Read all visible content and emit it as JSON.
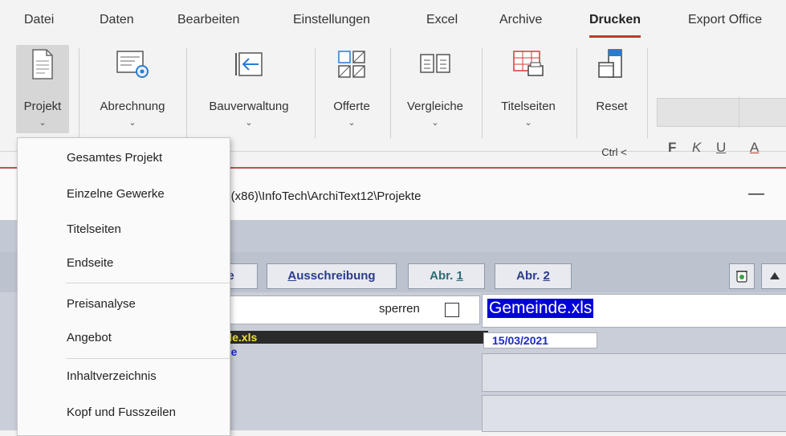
{
  "tabs": [
    {
      "label": "Datei"
    },
    {
      "label": "Daten"
    },
    {
      "label": "Bearbeiten"
    },
    {
      "label": "Einstellungen"
    },
    {
      "label": "Excel"
    },
    {
      "label": "Archive"
    },
    {
      "label": "Drucken"
    },
    {
      "label": "Export Office"
    }
  ],
  "ribbon": {
    "buttons": [
      {
        "label": "Projekt",
        "chevron": "⌄",
        "icon": "document-icon"
      },
      {
        "label": "Abrechnung",
        "chevron": "⌄",
        "icon": "invoice-settings-icon"
      },
      {
        "label": "Bauverwaltung",
        "chevron": "⌄",
        "icon": "arrow-left-box-icon"
      },
      {
        "label": "Offerte",
        "chevron": "⌄",
        "icon": "offer-grid-icon"
      },
      {
        "label": "Vergleiche",
        "chevron": "⌄",
        "icon": "compare-icon"
      },
      {
        "label": "Titelseiten",
        "chevron": "⌄",
        "icon": "table-print-icon"
      },
      {
        "label": "Reset",
        "icon": "reset-window-icon"
      }
    ],
    "shortcut": "Ctrl <",
    "format": {
      "bold": "F",
      "italic": "K",
      "underline": "U",
      "color": "A"
    }
  },
  "window": {
    "title_path": "s (x86)\\InfoTech\\ArchiText12\\Projekte",
    "minimize": "—"
  },
  "toolbar": {
    "buttons": [
      {
        "label": "te"
      },
      {
        "label_ul": "A",
        "label_rest": "usschreibung"
      },
      {
        "label_pre": "Abr. ",
        "label_ul": "1"
      },
      {
        "label_pre": "Abr. ",
        "label_ul": "2"
      }
    ]
  },
  "content": {
    "sperren": "sperren",
    "file_row": "nde.xls",
    "file_row2": "alle",
    "filename": "Gemeinde.xls",
    "date": "15/03/2021"
  },
  "menu": {
    "items": [
      {
        "label": "Gesamtes Projekt"
      },
      {
        "label": "Einzelne Gewerke"
      },
      {
        "label": "Titelseiten"
      },
      {
        "label": "Endseite"
      },
      {
        "label": "Preisanalyse"
      },
      {
        "label": "Angebot"
      },
      {
        "label": "Inhaltverzeichnis"
      },
      {
        "label": "Kopf und Fusszeilen"
      }
    ]
  },
  "colors": {
    "accent": "#c0392b",
    "selection": "#0000d8",
    "link": "#1c28c8"
  }
}
